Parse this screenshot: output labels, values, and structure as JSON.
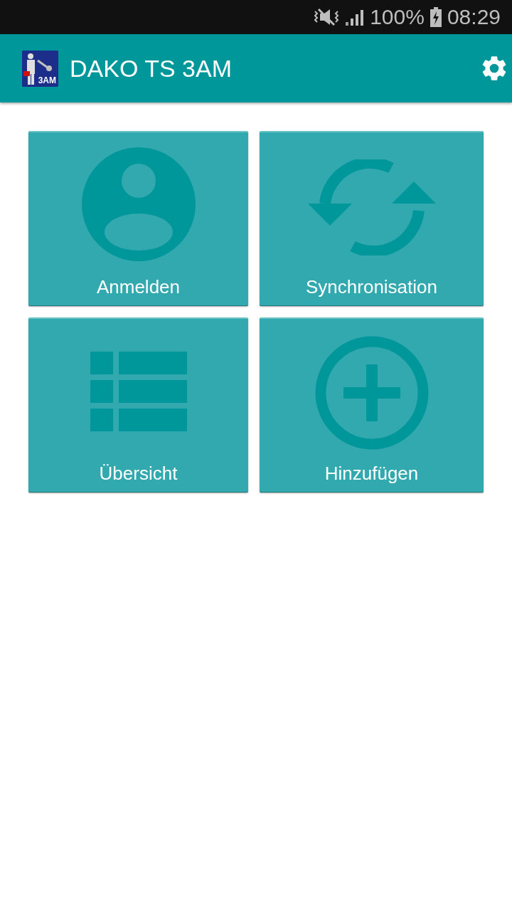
{
  "status_bar": {
    "battery": "100%",
    "time": "08:29"
  },
  "app_bar": {
    "logo_text": "3AM",
    "title": "DAKO TS 3AM"
  },
  "tiles": [
    {
      "kind": "user",
      "label": "Anmelden"
    },
    {
      "kind": "sync",
      "label": "Synchronisation"
    },
    {
      "kind": "list",
      "label": "Übersicht"
    },
    {
      "kind": "add",
      "label": "Hinzufügen"
    }
  ]
}
